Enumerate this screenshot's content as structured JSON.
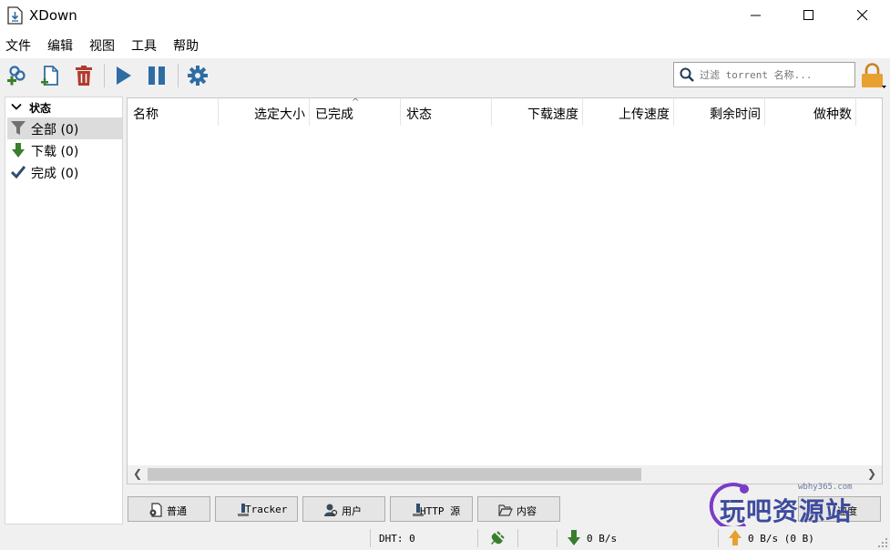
{
  "window": {
    "title": "XDown"
  },
  "menu": [
    "文件",
    "编辑",
    "视图",
    "工具",
    "帮助"
  ],
  "search": {
    "placeholder": "过滤 torrent 名称..."
  },
  "sidebar": {
    "header": "状态",
    "items": [
      {
        "label": "全部 (0)",
        "icon": "filter-icon"
      },
      {
        "label": "下载 (0)",
        "icon": "download-arrow-icon"
      },
      {
        "label": "完成 (0)",
        "icon": "checkmark-icon"
      }
    ]
  },
  "table": {
    "columns": [
      "名称",
      "选定大小",
      "已完成",
      "状态",
      "下载速度",
      "上传速度",
      "剩余时间",
      "做种数"
    ],
    "rows": []
  },
  "tabs": [
    "普通",
    "Tracker",
    "用户",
    "HTTP 源",
    "内容",
    "速度"
  ],
  "status": {
    "dht": "DHT: 0",
    "download_speed": "0 B/s",
    "upload_speed": "0 B/s (0 B)"
  },
  "watermark": {
    "url": "wbhy365.com",
    "text": "玩吧资源站"
  },
  "colors": {
    "accent_blue": "#2e6da4",
    "green": "#3a7d2e",
    "red": "#b03a2e",
    "orange": "#e8a030"
  }
}
